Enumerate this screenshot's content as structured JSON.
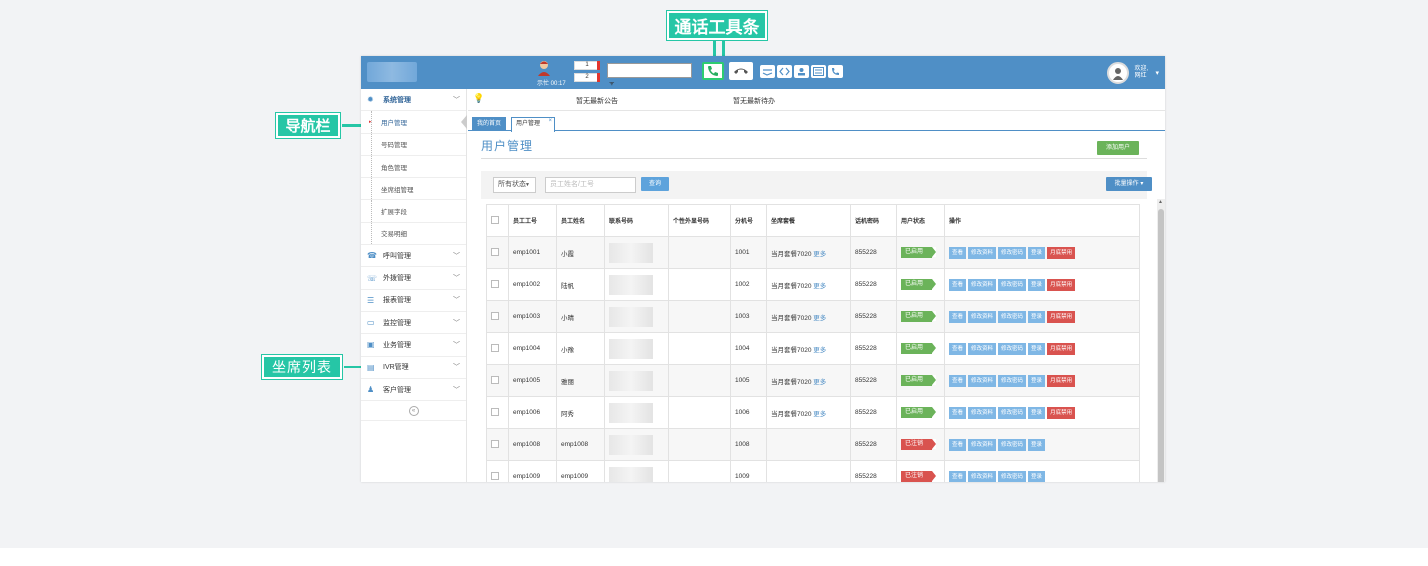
{
  "callouts": {
    "toolbar": "通话工具条",
    "nav": "导航栏",
    "agents": "坐席列表"
  },
  "topbar": {
    "agent_status": "示忙 00:17",
    "counter1": "1",
    "counter2": "2",
    "signal": "ᯤ",
    "welcome_line1": "欢迎,",
    "welcome_line2": "网红"
  },
  "sidebar": {
    "system": "系统管理",
    "sub_items": [
      "用户管理",
      "号码管理",
      "角色管理",
      "坐席组管理",
      "扩展字段",
      "交易明细"
    ],
    "groups": [
      {
        "label": "呼叫管理",
        "icon": "phone-icon"
      },
      {
        "label": "外拨管理",
        "icon": "outbound-icon"
      },
      {
        "label": "报表管理",
        "icon": "report-icon"
      },
      {
        "label": "监控管理",
        "icon": "monitor-icon"
      },
      {
        "label": "业务管理",
        "icon": "briefcase-icon"
      },
      {
        "label": "IVR管理",
        "icon": "ivr-icon"
      },
      {
        "label": "客户管理",
        "icon": "customers-icon"
      }
    ]
  },
  "notice": {
    "announcement": "暂无最新公告",
    "todo": "暂无最新待办"
  },
  "tabs": {
    "home": "我的首页",
    "users": "用户管理"
  },
  "page": {
    "title": "用户管理",
    "add_button": "添加用户"
  },
  "filter": {
    "status": "所有状态",
    "search_placeholder": "员工姓名/工号",
    "query": "查询",
    "batch": "批量操作 ▾"
  },
  "table": {
    "headers": [
      "员工工号",
      "员工姓名",
      "联系号码",
      "个性外显号码",
      "分机号",
      "坐席套餐",
      "话机密码",
      "用户状态",
      "操作"
    ],
    "rows": [
      {
        "id": "emp1001",
        "name": "小霞",
        "ext": "1001",
        "plan": "当月套餐7020",
        "more": "更多",
        "pwd": "855228",
        "status": "已启用",
        "active": true
      },
      {
        "id": "emp1002",
        "name": "陆帆",
        "ext": "1002",
        "plan": "当月套餐7020",
        "more": "更多",
        "pwd": "855228",
        "status": "已启用",
        "active": true
      },
      {
        "id": "emp1003",
        "name": "小晴",
        "ext": "1003",
        "plan": "当月套餐7020",
        "more": "更多",
        "pwd": "855228",
        "status": "已启用",
        "active": true
      },
      {
        "id": "emp1004",
        "name": "小豫",
        "ext": "1004",
        "plan": "当月套餐7020",
        "more": "更多",
        "pwd": "855228",
        "status": "已启用",
        "active": true
      },
      {
        "id": "emp1005",
        "name": "雅丽",
        "ext": "1005",
        "plan": "当月套餐7020",
        "more": "更多",
        "pwd": "855228",
        "status": "已启用",
        "active": true
      },
      {
        "id": "emp1006",
        "name": "阿秀",
        "ext": "1006",
        "plan": "当月套餐7020",
        "more": "更多",
        "pwd": "855228",
        "status": "已启用",
        "active": true
      },
      {
        "id": "emp1008",
        "name": "emp1008",
        "ext": "1008",
        "plan": "",
        "more": "",
        "pwd": "855228",
        "status": "已注销",
        "active": false
      },
      {
        "id": "emp1009",
        "name": "emp1009",
        "ext": "1009",
        "plan": "",
        "more": "",
        "pwd": "855228",
        "status": "已注销",
        "active": false
      }
    ],
    "ops": [
      "查看",
      "修改资料",
      "修改密码",
      "登录",
      "月底禁用"
    ]
  },
  "colors": {
    "accent": "#4f8fc6",
    "callout": "#26c6a6",
    "enabled": "#6bb35a",
    "disabled": "#d9534f"
  }
}
